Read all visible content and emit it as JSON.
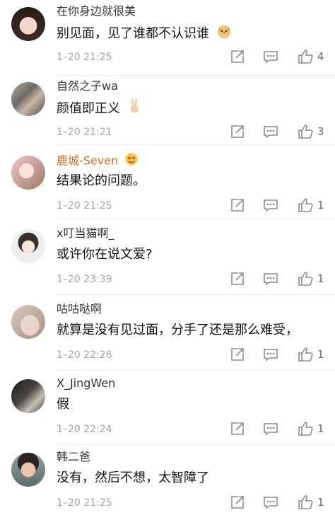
{
  "comments": [
    {
      "username": "在你身边就很美",
      "text": "别见面，见了谁都不认识谁",
      "time": "1–20 21:25",
      "likes": "4",
      "emoji": "dog-face-icon"
    },
    {
      "username": "自然之子wa",
      "text": "颜值即正义",
      "time": "1–20 21:21",
      "likes": "3",
      "emoji": "victory-hand-icon"
    },
    {
      "username": "鹿城-Seven",
      "text": "结果论的问题。",
      "time": "1–20 21:25",
      "likes": "1",
      "emoji": "heart-eyes-icon"
    },
    {
      "username": "x叮当猫啊_",
      "text": "或许你在说文爱?",
      "time": "1–20 23:39",
      "likes": "1"
    },
    {
      "username": "咕咕哒啊",
      "text": "就算是没有见过面，分手了还是那么难受，",
      "time": "1–20 22:26",
      "likes": "1"
    },
    {
      "username": "X_JingWen",
      "text": "假",
      "time": "1–20 22:24",
      "likes": "1"
    },
    {
      "username": "韩二爸",
      "text": "没有，然后不想，太智障了",
      "time": "1–20 21:25",
      "likes": "1"
    }
  ],
  "colors": {
    "vip_name": "#e36c1a",
    "name": "#333333",
    "time": "#a3a3a3",
    "icon": "#8b8b8b"
  },
  "icons": [
    "share-icon",
    "comment-icon",
    "like-icon"
  ]
}
